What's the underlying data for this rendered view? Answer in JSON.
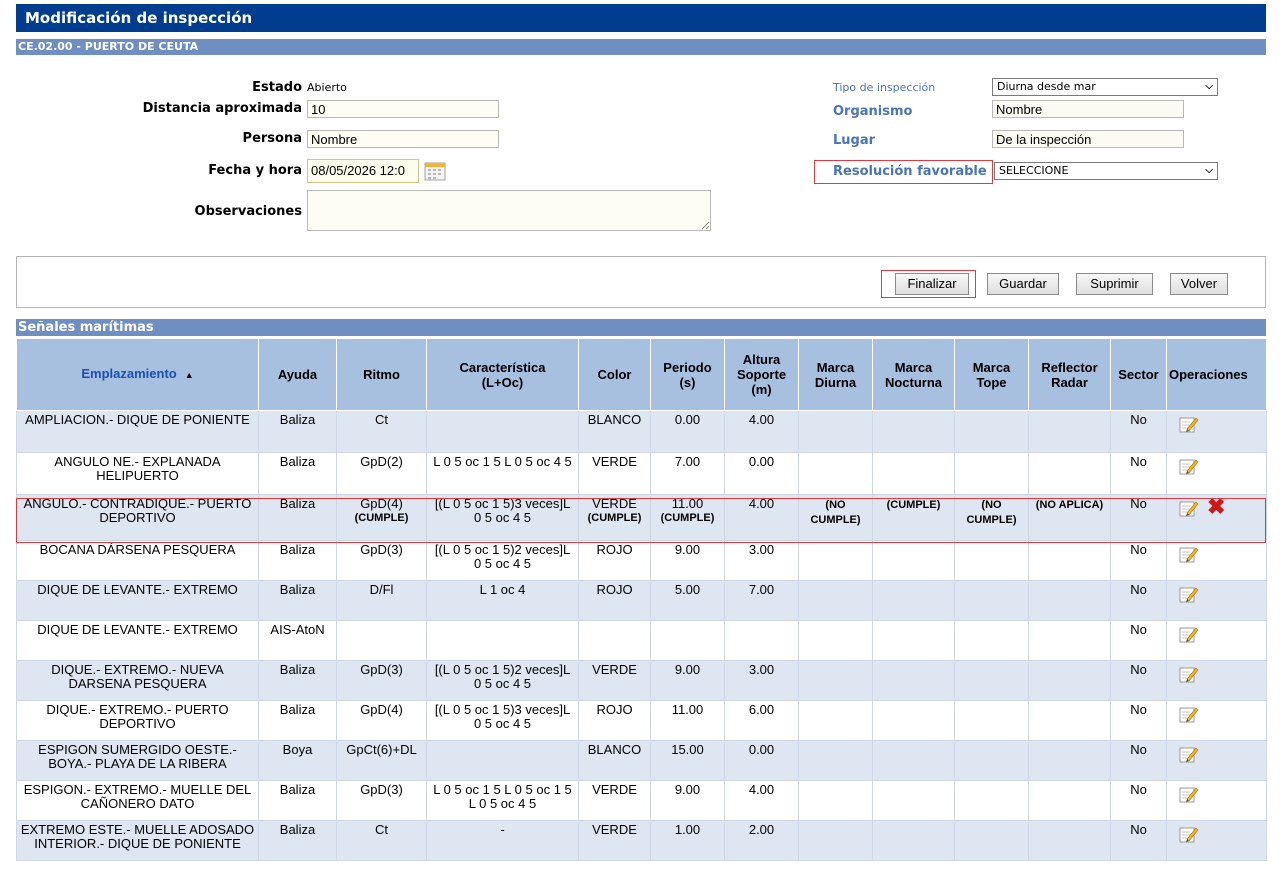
{
  "header": {
    "title": "Modificación de inspección",
    "subtitle": "CE.02.00 - PUERTO DE CEUTA"
  },
  "form": {
    "estado_label": "Estado",
    "estado_value": "Abierto",
    "distancia_label": "Distancia aproximada",
    "distancia_value": "10",
    "persona_label": "Persona",
    "persona_value": "Nombre",
    "fecha_label": "Fecha y hora",
    "fecha_value": "08/05/2026 12:0",
    "observaciones_label": "Observaciones",
    "observaciones_value": "",
    "tipo_label": "Tipo de inspección",
    "tipo_value": "Diurna desde mar",
    "organismo_label": "Organismo",
    "organismo_value": "Nombre",
    "lugar_label": "Lugar",
    "lugar_value": "De la inspección",
    "resolucion_label": "Resolución favorable",
    "resolucion_value": "SELECCIONE"
  },
  "toolbar": {
    "finalizar": "Finalizar",
    "guardar": "Guardar",
    "suprimir": "Suprimir",
    "volver": "Volver"
  },
  "section": {
    "title": "Señales marítimas"
  },
  "table": {
    "headers": {
      "emplazamiento": "Emplazamiento",
      "ayuda": "Ayuda",
      "ritmo": "Ritmo",
      "caracteristica_1": "Característica",
      "caracteristica_2": "(L+Oc)",
      "color": "Color",
      "periodo_1": "Periodo",
      "periodo_2": "(s)",
      "altura_1": "Altura",
      "altura_2": "Soporte",
      "altura_3": "(m)",
      "marca_diurna_1": "Marca",
      "marca_diurna_2": "Diurna",
      "marca_nocturna_1": "Marca",
      "marca_nocturna_2": "Nocturna",
      "marca_tope_1": "Marca",
      "marca_tope_2": "Tope",
      "reflector_1": "Reflector",
      "reflector_2": "Radar",
      "sector": "Sector",
      "operaciones": "Operaciones"
    },
    "rows": [
      {
        "emplazamiento": "AMPLIACION.- DIQUE DE PONIENTE",
        "ayuda": "Baliza",
        "ritmo": "Ct",
        "caracteristica": "",
        "color": "BLANCO",
        "periodo": "0.00",
        "altura": "4.00",
        "sector": "No"
      },
      {
        "emplazamiento": "ANGULO NE.- EXPLANADA HELIPUERTO",
        "ayuda": "Baliza",
        "ritmo": "GpD(2)",
        "caracteristica": "L 0 5 oc 1 5 L 0 5 oc 4 5",
        "color": "VERDE",
        "periodo": "7.00",
        "altura": "0.00",
        "sector": "No"
      },
      {
        "emplazamiento": "ANGULO.- CONTRADIQUE.- PUERTO DEPORTIVO",
        "ayuda": "Baliza",
        "ritmo": "GpD(4)",
        "ritmo_status": "(CUMPLE)",
        "caracteristica": "[(L 0 5 oc 1 5)3 veces]L 0 5 oc 4 5",
        "color": "VERDE",
        "color_status": "(CUMPLE)",
        "periodo": "11.00",
        "periodo_status": "(CUMPLE)",
        "altura": "4.00",
        "marca_diurna": "(NO CUMPLE)",
        "marca_nocturna": "(CUMPLE)",
        "marca_tope": "(NO CUMPLE)",
        "reflector": "(NO APLICA)",
        "sector": "No"
      },
      {
        "emplazamiento": "BOCANA DÁRSENA PESQUERA",
        "ayuda": "Baliza",
        "ritmo": "GpD(3)",
        "caracteristica": "[(L 0 5 oc 1 5)2 veces]L 0 5 oc 4 5",
        "color": "ROJO",
        "periodo": "9.00",
        "altura": "3.00",
        "sector": "No"
      },
      {
        "emplazamiento": "DIQUE DE LEVANTE.- EXTREMO",
        "ayuda": "Baliza",
        "ritmo": "D/Fl",
        "caracteristica": "L 1 oc 4",
        "color": "ROJO",
        "periodo": "5.00",
        "altura": "7.00",
        "sector": "No"
      },
      {
        "emplazamiento": "DIQUE DE LEVANTE.- EXTREMO",
        "ayuda": "AIS-AtoN",
        "ritmo": "",
        "caracteristica": "",
        "color": "",
        "periodo": "",
        "altura": "",
        "sector": "No"
      },
      {
        "emplazamiento": "DIQUE.- EXTREMO.- NUEVA DARSENA PESQUERA",
        "ayuda": "Baliza",
        "ritmo": "GpD(3)",
        "caracteristica": "[(L 0 5 oc 1 5)2 veces]L 0 5 oc 4 5",
        "color": "VERDE",
        "periodo": "9.00",
        "altura": "3.00",
        "sector": "No"
      },
      {
        "emplazamiento": "DIQUE.- EXTREMO.- PUERTO DEPORTIVO",
        "ayuda": "Baliza",
        "ritmo": "GpD(4)",
        "caracteristica": "[(L 0 5 oc 1 5)3 veces]L 0 5 oc 4 5",
        "color": "ROJO",
        "periodo": "11.00",
        "altura": "6.00",
        "sector": "No"
      },
      {
        "emplazamiento": "ESPIGON SUMERGIDO OESTE.- BOYA.- PLAYA DE LA RIBERA",
        "ayuda": "Boya",
        "ritmo": "GpCt(6)+DL",
        "caracteristica": "",
        "color": "BLANCO",
        "periodo": "15.00",
        "altura": "0.00",
        "sector": "No"
      },
      {
        "emplazamiento": "ESPIGON.- EXTREMO.- MUELLE DEL CAÑONERO DATO",
        "ayuda": "Baliza",
        "ritmo": "GpD(3)",
        "caracteristica": "L 0 5 oc 1 5 L 0 5 oc 1 5 L 0 5 oc 4 5",
        "color": "VERDE",
        "periodo": "9.00",
        "altura": "4.00",
        "sector": "No"
      },
      {
        "emplazamiento": "EXTREMO ESTE.- MUELLE ADOSADO INTERIOR.- DIQUE DE PONIENTE",
        "ayuda": "Baliza",
        "ritmo": "Ct",
        "caracteristica": "-",
        "color": "VERDE",
        "periodo": "1.00",
        "altura": "2.00",
        "sector": "No"
      }
    ]
  },
  "icons": {
    "edit": "edit-icon",
    "delete": "delete-icon",
    "calendar": "calendar-icon",
    "sort": "sort-asc-icon"
  },
  "colors": {
    "title_bar": "#003d8f",
    "section_bar": "#6f8fc2",
    "header_row": "#a8c0e0",
    "odd_row": "#dde6f1",
    "highlight": "#e1393d",
    "link": "#4a74b9"
  }
}
